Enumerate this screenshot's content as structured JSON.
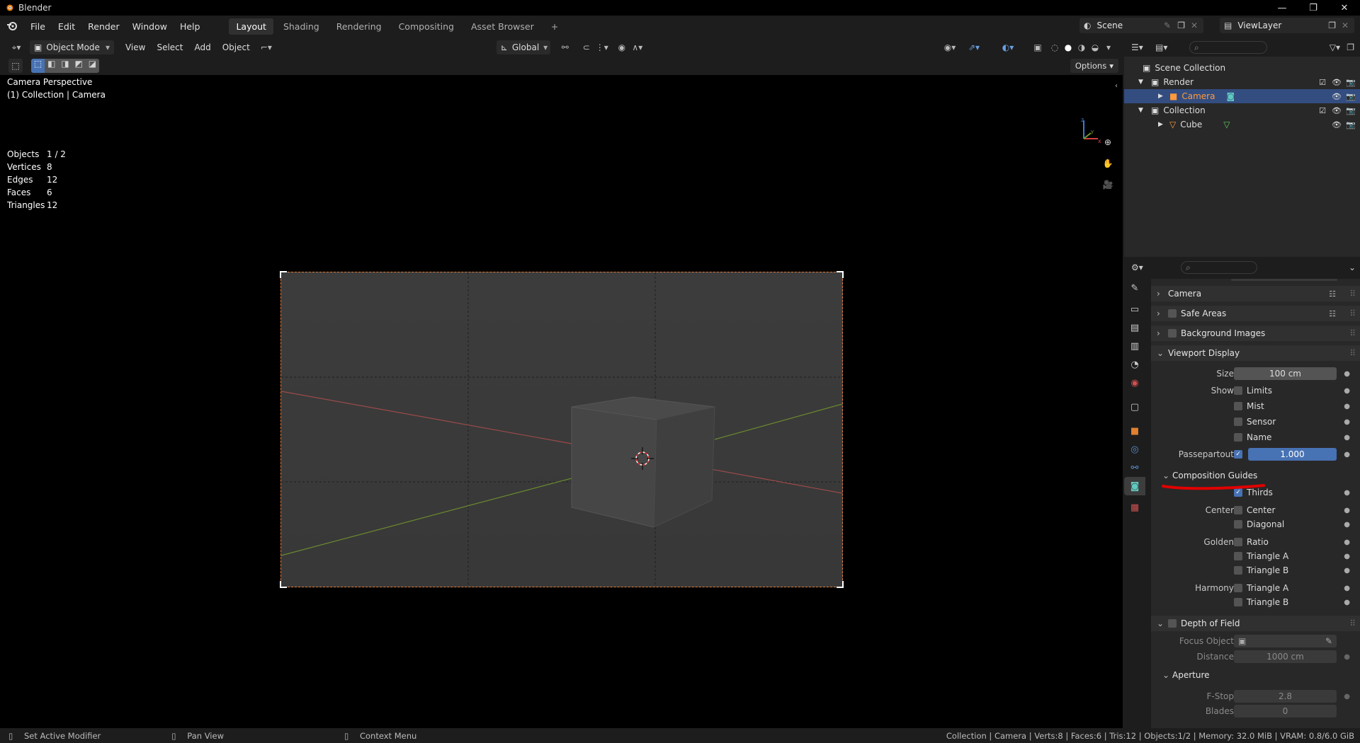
{
  "window": {
    "title": "Blender",
    "controls": [
      "—",
      "❐",
      "✕"
    ]
  },
  "menu": {
    "items": [
      "File",
      "Edit",
      "Render",
      "Window",
      "Help"
    ],
    "workspaces": [
      "Layout",
      "Shading",
      "Rendering",
      "Compositing",
      "Asset Browser"
    ],
    "add_tab": "+",
    "scene": "Scene",
    "view_layer": "ViewLayer"
  },
  "viewport": {
    "mode": "Object Mode",
    "menus": [
      "View",
      "Select",
      "Add",
      "Object"
    ],
    "orientation": "Global",
    "options_label": "Options",
    "overlay_title": "Camera Perspective",
    "overlay_subtitle": "(1) Collection | Camera",
    "stats": [
      {
        "label": "Objects",
        "value": "1 / 2"
      },
      {
        "label": "Vertices",
        "value": "8"
      },
      {
        "label": "Edges",
        "value": "12"
      },
      {
        "label": "Faces",
        "value": "6"
      },
      {
        "label": "Triangles",
        "value": "12"
      }
    ]
  },
  "outliner": {
    "rows": [
      {
        "label": "Scene Collection"
      },
      {
        "label": "Render"
      },
      {
        "label": "Camera"
      },
      {
        "label": "Collection"
      },
      {
        "label": "Cube"
      }
    ]
  },
  "properties": {
    "panels": {
      "camera": "Camera",
      "safe_areas": "Safe Areas",
      "background_images": "Background Images",
      "viewport_display": "Viewport Display",
      "composition_guides": "Composition Guides",
      "depth_of_field": "Depth of Field",
      "aperture": "Aperture"
    },
    "viewport_display": {
      "size_label": "Size",
      "size_value": "100 cm",
      "show_label": "Show",
      "limits": "Limits",
      "mist": "Mist",
      "sensor": "Sensor",
      "name": "Name",
      "passepartout_label": "Passepartout",
      "passepartout_value": "1.000"
    },
    "composition": {
      "thirds": "Thirds",
      "center_label": "Center",
      "center": "Center",
      "diagonal": "Diagonal",
      "golden_label": "Golden",
      "ratio": "Ratio",
      "triangle_a": "Triangle A",
      "triangle_b": "Triangle B",
      "harmony_label": "Harmony",
      "h_triangle_a": "Triangle A",
      "h_triangle_b": "Triangle B"
    },
    "dof": {
      "focus_label": "Focus Object",
      "distance_label": "Distance",
      "distance_value": "1000 cm",
      "fstop_label": "F-Stop",
      "fstop_value": "2.8",
      "blades_label": "Blades",
      "blades_value": "0"
    }
  },
  "status": {
    "left": [
      "Set Active Modifier",
      "Pan View",
      "Context Menu"
    ],
    "right": "Collection | Camera | Verts:8 | Faces:6 | Tris:12 | Objects:1/2 | Memory: 32.0 MiB | VRAM: 0.8/6.0 GiB"
  },
  "colors": {
    "accent_blue": "#4772b3",
    "selection": "#334d80",
    "camera_frame": "#e07b3a",
    "annotation_red": "#e00000"
  }
}
